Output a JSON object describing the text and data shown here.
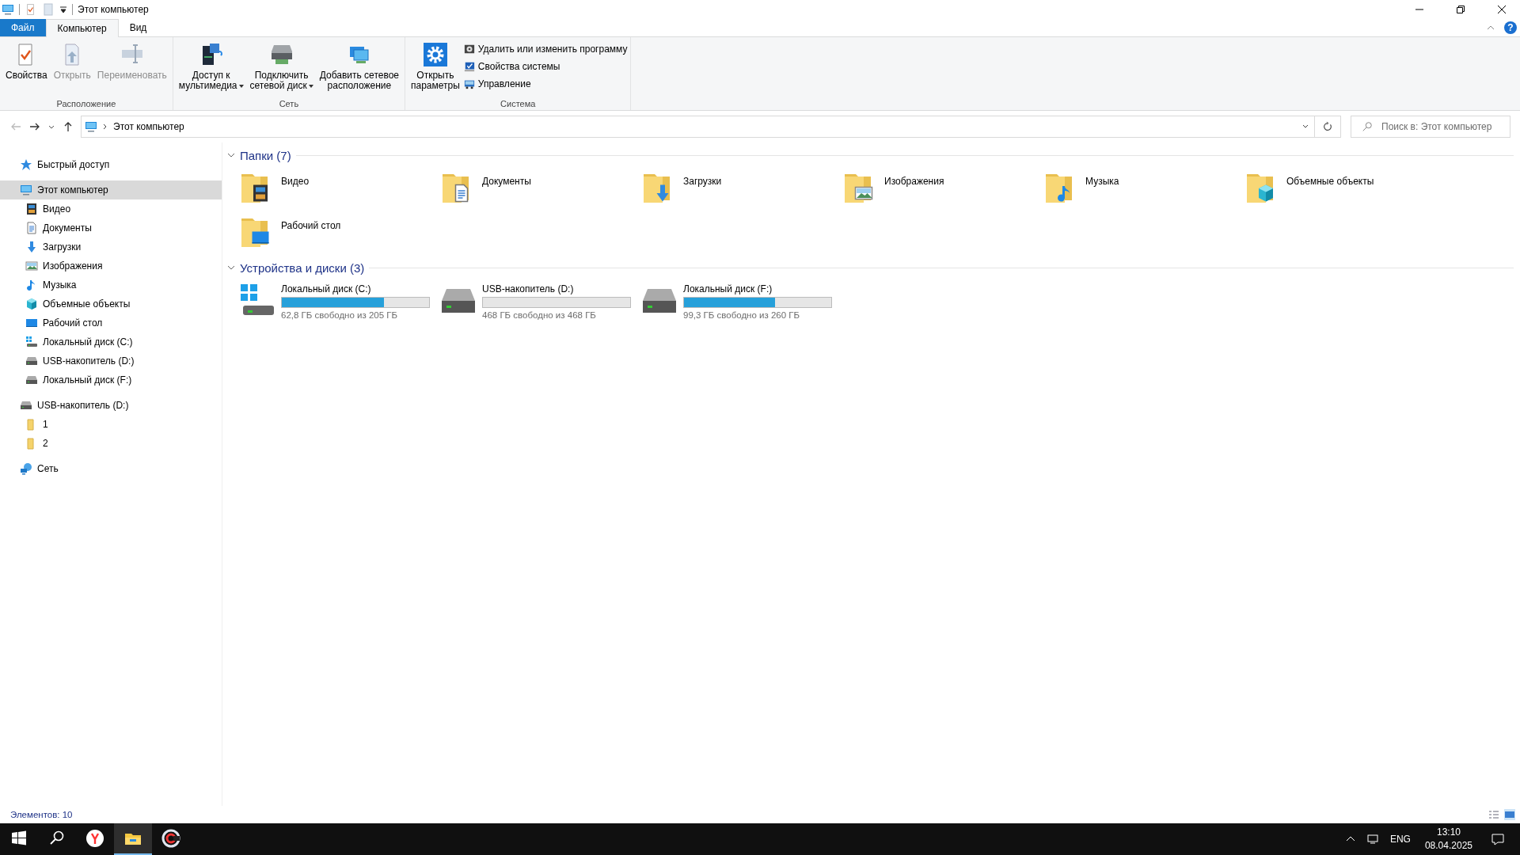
{
  "window": {
    "title": "Этот компьютер",
    "help": "?"
  },
  "ribbon_tabs": [
    {
      "label": "Файл",
      "kind": "file",
      "selected": false
    },
    {
      "label": "Компьютер",
      "kind": "tab",
      "selected": true
    },
    {
      "label": "Вид",
      "kind": "tab",
      "selected": false
    }
  ],
  "ribbon_groups": [
    {
      "label": "Расположение",
      "buttons": [
        {
          "lines": [
            "Свойства"
          ],
          "kind": "properties",
          "disabled": false,
          "dropdown": false
        },
        {
          "lines": [
            "Открыть"
          ],
          "kind": "open",
          "disabled": true,
          "dropdown": false
        },
        {
          "lines": [
            "Переименовать"
          ],
          "kind": "rename",
          "disabled": true,
          "dropdown": false
        }
      ]
    },
    {
      "label": "Сеть",
      "buttons": [
        {
          "lines": [
            "Доступ к",
            "мультимедиа"
          ],
          "kind": "media",
          "disabled": false,
          "dropdown": true
        },
        {
          "lines": [
            "Подключить",
            "сетевой диск"
          ],
          "kind": "map-drive",
          "disabled": false,
          "dropdown": true
        },
        {
          "lines": [
            "Добавить сетевое",
            "расположение"
          ],
          "kind": "add-location",
          "disabled": false,
          "dropdown": false
        }
      ]
    },
    {
      "label": "Система",
      "buttons": [
        {
          "lines": [
            "Открыть",
            "параметры"
          ],
          "kind": "settings",
          "disabled": false,
          "dropdown": false
        }
      ],
      "small_buttons": [
        {
          "label": "Удалить или изменить программу",
          "kind": "uninstall"
        },
        {
          "label": "Свойства системы",
          "kind": "system"
        },
        {
          "label": "Управление",
          "kind": "manage"
        }
      ]
    }
  ],
  "address_bar": {
    "path": "Этот компьютер",
    "search_placeholder": "Поиск в: Этот компьютер"
  },
  "sidebar": {
    "items": [
      {
        "label": "Быстрый доступ",
        "kind": "star",
        "selected": false
      },
      {
        "label": "Этот компьютер",
        "kind": "pc",
        "selected": true,
        "children": [
          {
            "label": "Видео",
            "kind": "video",
            "selected": false
          },
          {
            "label": "Документы",
            "kind": "documents",
            "selected": false
          },
          {
            "label": "Загрузки",
            "kind": "downloads",
            "selected": false
          },
          {
            "label": "Изображения",
            "kind": "pictures",
            "selected": false
          },
          {
            "label": "Музыка",
            "kind": "music",
            "selected": false
          },
          {
            "label": "Объемные объекты",
            "kind": "objects",
            "selected": false
          },
          {
            "label": "Рабочий стол",
            "kind": "desktop",
            "selected": false
          },
          {
            "label": "Локальный диск (C:)",
            "kind": "drivewin",
            "selected": false
          },
          {
            "label": "USB-накопитель (D:)",
            "kind": "drive",
            "selected": false
          },
          {
            "label": "Локальный диск (F:)",
            "kind": "drive",
            "selected": false
          }
        ]
      },
      {
        "label": "USB-накопитель (D:)",
        "kind": "drive",
        "selected": false,
        "children": [
          {
            "label": "1",
            "kind": "folder",
            "selected": false
          },
          {
            "label": "2",
            "kind": "folder",
            "selected": false
          }
        ]
      },
      {
        "label": "Сеть",
        "kind": "network",
        "selected": false
      }
    ]
  },
  "sections": [
    {
      "title": "Папки (7)",
      "kind": "folders",
      "expanded": true,
      "items": [
        {
          "name": "Видео",
          "kind": "video"
        },
        {
          "name": "Документы",
          "kind": "documents"
        },
        {
          "name": "Загрузки",
          "kind": "downloads"
        },
        {
          "name": "Изображения",
          "kind": "pictures"
        },
        {
          "name": "Музыка",
          "kind": "music"
        },
        {
          "name": "Объемные объекты",
          "kind": "objects"
        },
        {
          "name": "Рабочий стол",
          "kind": "desktop"
        }
      ]
    },
    {
      "title": "Устройства и диски (3)",
      "kind": "drives",
      "expanded": true,
      "items": [
        {
          "name": "Локальный диск (C:)",
          "kind": "drivewin",
          "level": 0.694,
          "free": "62,8 ГБ свободно из 205 ГБ"
        },
        {
          "name": "USB-накопитель (D:)",
          "kind": "drive",
          "level": 0,
          "free": "468 ГБ свободно из 468 ГБ"
        },
        {
          "name": "Локальный диск (F:)",
          "kind": "drive",
          "level": 0.618,
          "free": "99,3 ГБ свободно из 260 ГБ"
        }
      ]
    }
  ],
  "status_bar": {
    "count": "Элементов: 10",
    "views": [
      {
        "kind": "details",
        "selected": false
      },
      {
        "kind": "tiles",
        "selected": true
      }
    ]
  },
  "taskbar": {
    "apps": [
      {
        "kind": "start",
        "selected": false
      },
      {
        "kind": "search",
        "selected": false
      },
      {
        "kind": "browser",
        "selected": false
      },
      {
        "kind": "explorer",
        "selected": true
      },
      {
        "kind": "app",
        "selected": false
      }
    ],
    "language": "ENG",
    "time": "13:10",
    "date": "08.04.2025"
  }
}
